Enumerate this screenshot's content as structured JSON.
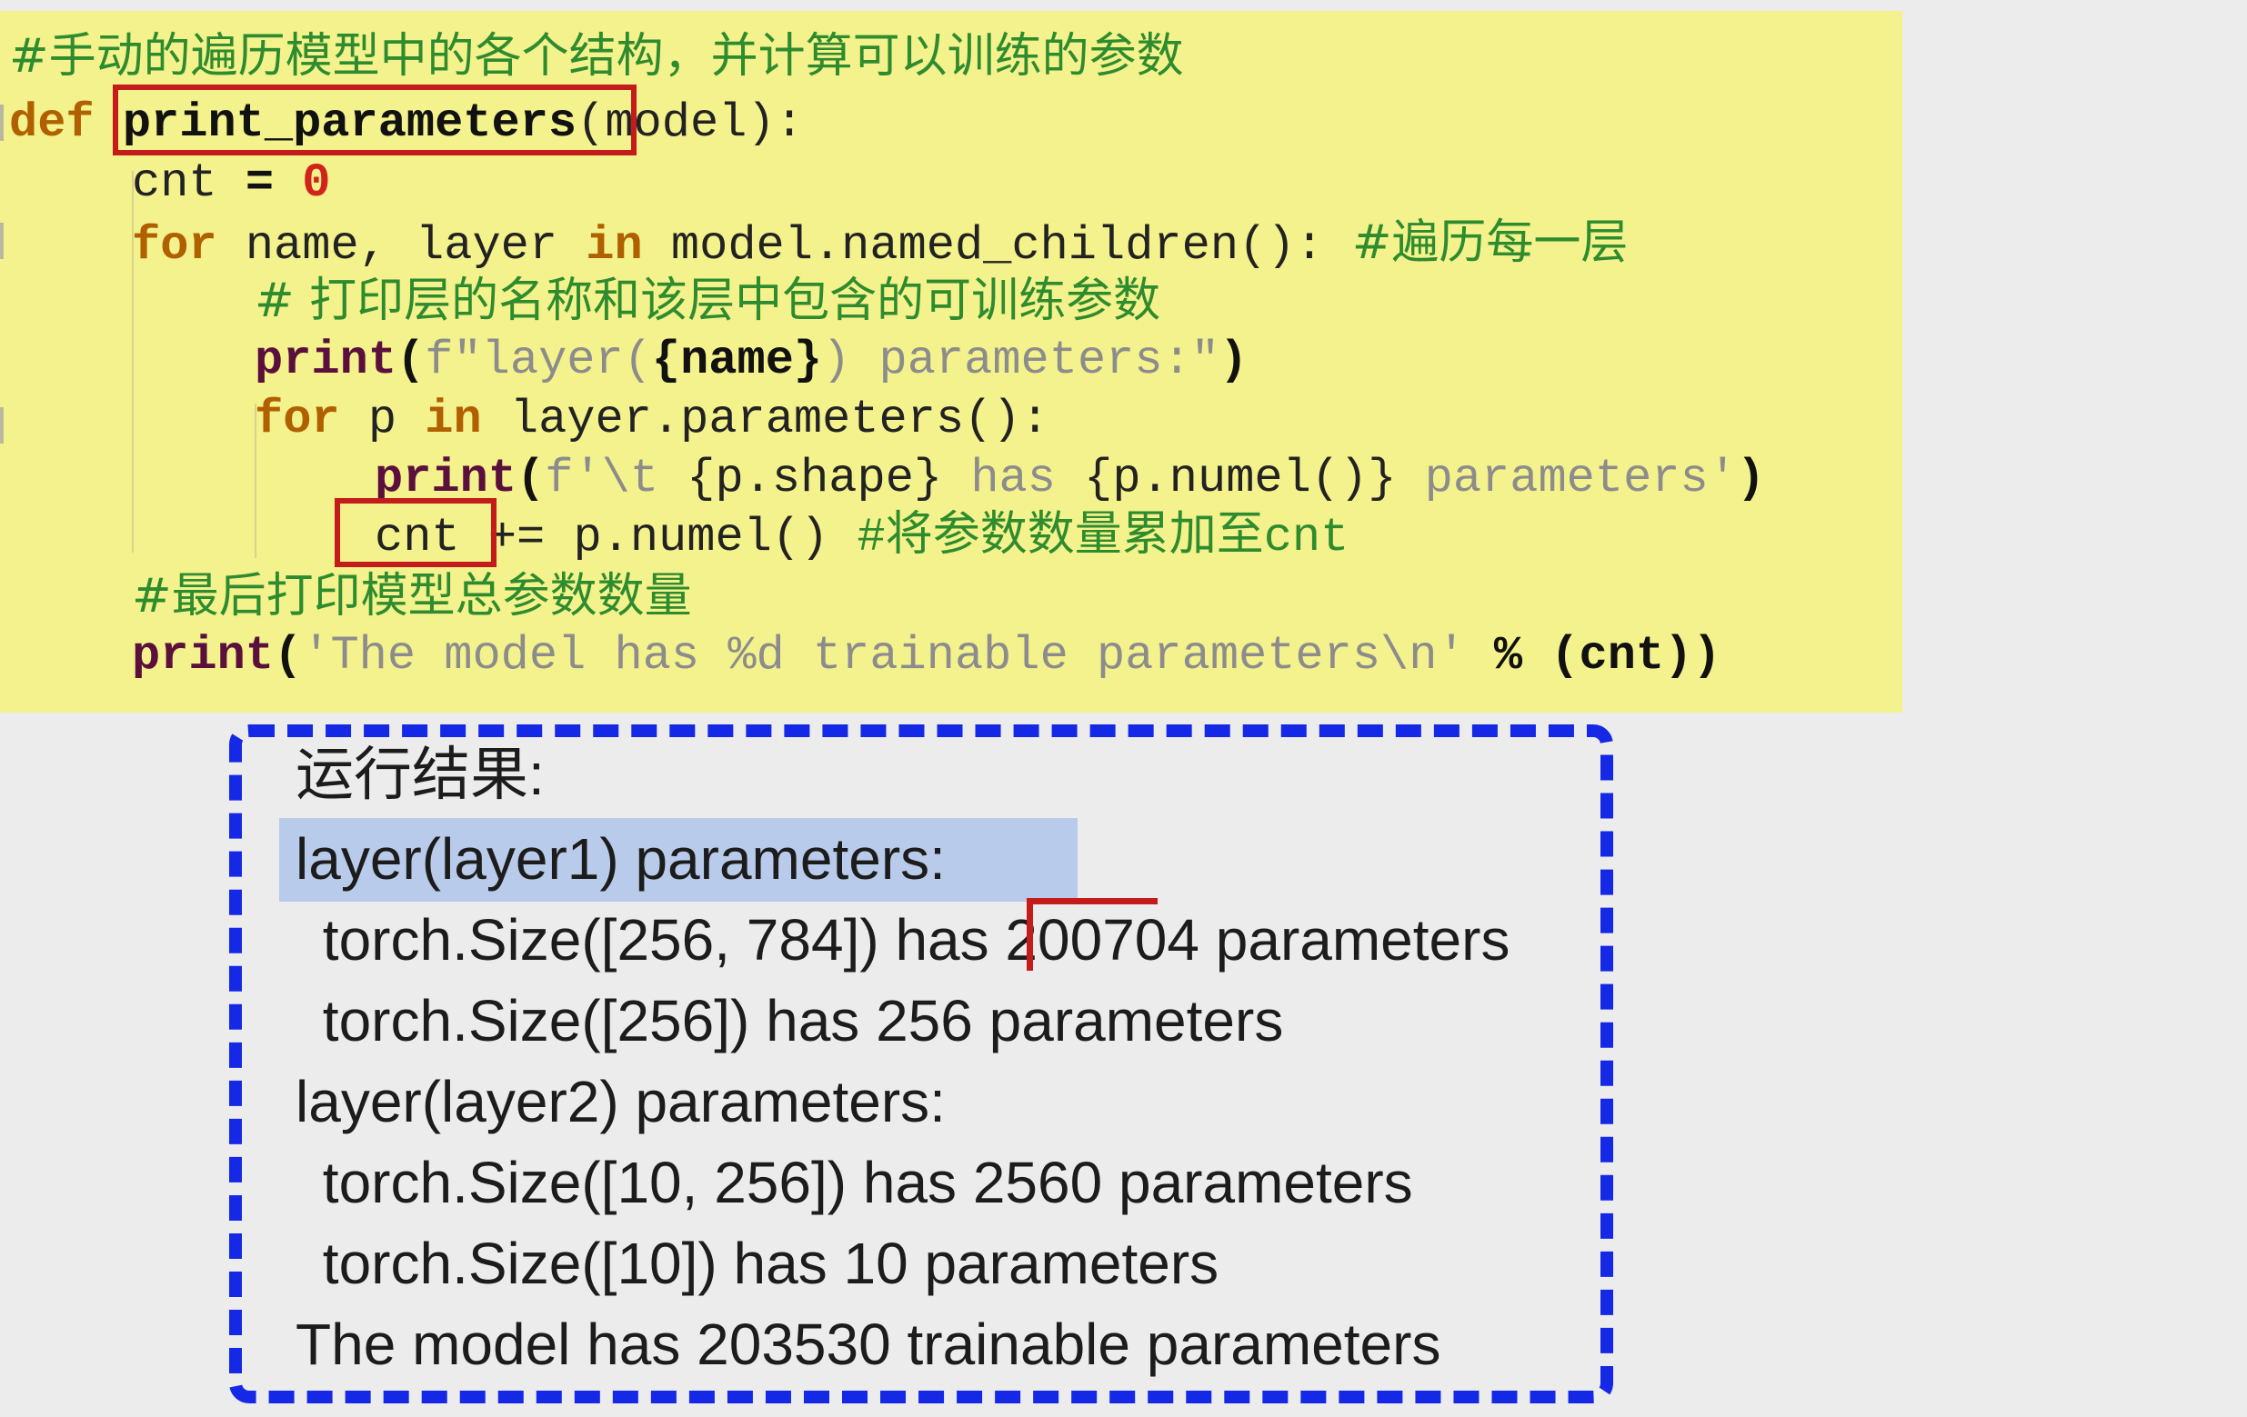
{
  "code": {
    "comment_title": "#手动的遍历模型中的各个结构，并计算可以训练的参数",
    "def_kw": "def",
    "func_name": "print_parameters",
    "def_args": "(model):",
    "cnt_var": "cnt",
    "cnt_eq": " = ",
    "cnt_zero": "0",
    "for1_kw": "for",
    "for1_a": " name, layer ",
    "in1_kw": "in",
    "for1_b": " model.named_children(): ",
    "for1_comment": "#遍历每一层",
    "comment_print": "# 打印层的名称和该层中包含的可训练参数",
    "print1_fn": "print",
    "print1_a": "(",
    "print1_str1": "f\"layer(",
    "print1_mid": "{name}",
    "print1_str2": ") parameters:\"",
    "print1_b": ")",
    "for2_kw": "for",
    "for2_a": " p ",
    "in2_kw": "in",
    "for2_b": " layer.parameters():",
    "print2_fn": "print",
    "print2_a": "(",
    "print2_str1": "f'\\t ",
    "print2_mid1": "{p.shape}",
    "print2_str2": " has ",
    "print2_mid2": "{p.numel()}",
    "print2_str3": " parameters'",
    "print2_b": ")",
    "cnt2_var": "cnt",
    "cnt2_op": " += p.numel() ",
    "cnt2_comment": "#将参数数量累加至cnt",
    "comment_total": "#最后打印模型总参数数量",
    "print3_fn": "print",
    "print3_a": "(",
    "print3_str": "'The model has %d trainable parameters\\n'",
    "print3_b": " % (cnt))"
  },
  "output": {
    "heading": "运行结果:",
    "lines": [
      "layer(layer1) parameters:",
      " torch.Size([256, 784]) has 200704 parameters",
      " torch.Size([256]) has 256 parameters",
      "layer(layer2) parameters:",
      " torch.Size([10, 256]) has 2560 parameters",
      " torch.Size([10]) has 10 parameters",
      "The model has 203530 trainable parameters"
    ]
  },
  "colors": {
    "code_background": "#f4f28c",
    "output_border": "#1428e6",
    "annotation_red": "#c41b1b",
    "line_highlight": "#b9cbea"
  }
}
